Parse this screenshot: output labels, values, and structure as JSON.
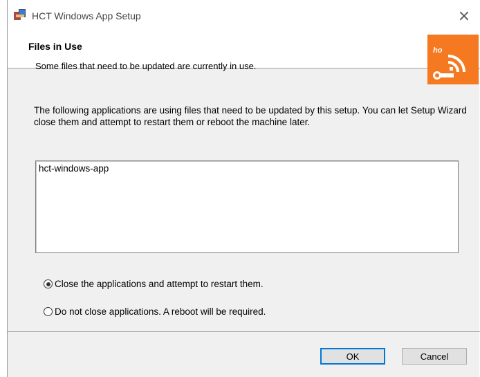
{
  "window": {
    "title": "HCT Windows App Setup",
    "close_glyph": "×"
  },
  "banner": {
    "title": "Files in Use",
    "subtitle": "Some files that need to be updated are currently in use.",
    "logo_color": "#f47920"
  },
  "content": {
    "description": "The following applications are using files that need to be updated by this setup. You can let Setup Wizard close them and attempt to restart them or reboot the machine later.",
    "applications": [
      "hct-windows-app"
    ]
  },
  "options": [
    {
      "label": "Close the applications and attempt to restart them.",
      "selected": true
    },
    {
      "label": "Do not close applications. A reboot will be required.",
      "selected": false
    }
  ],
  "buttons": {
    "ok": "OK",
    "cancel": "Cancel"
  },
  "colors": {
    "accent": "#0078d7",
    "brand_orange": "#f47920"
  }
}
